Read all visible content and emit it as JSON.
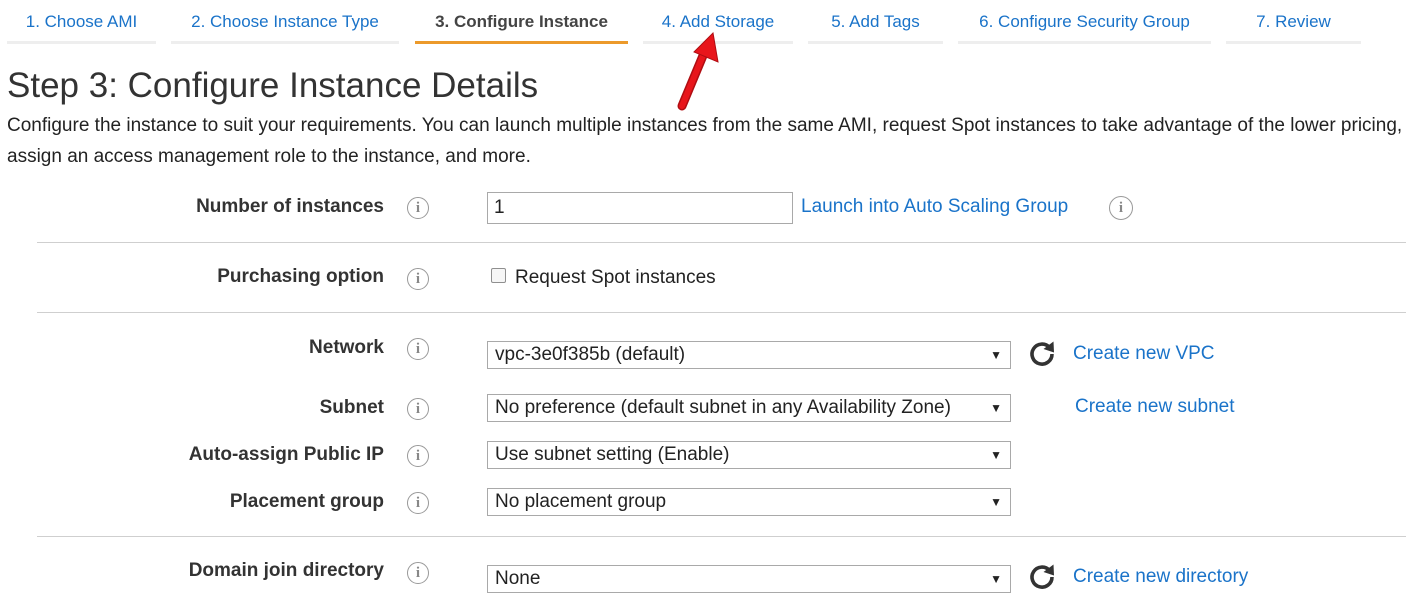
{
  "wizard": {
    "tabs": [
      {
        "label": "1. Choose AMI"
      },
      {
        "label": "2. Choose Instance Type"
      },
      {
        "label": "3. Configure Instance"
      },
      {
        "label": "4. Add Storage"
      },
      {
        "label": "5. Add Tags"
      },
      {
        "label": "6. Configure Security Group"
      },
      {
        "label": "7. Review"
      }
    ],
    "active_index": 2
  },
  "page": {
    "title": "Step 3: Configure Instance Details",
    "description": "Configure the instance to suit your requirements. You can launch multiple instances from the same AMI, request Spot instances to take advantage of the lower pricing, assign an access management role to the instance, and more."
  },
  "form": {
    "number_of_instances": {
      "label": "Number of instances",
      "value": "1",
      "link": "Launch into Auto Scaling Group"
    },
    "purchasing_option": {
      "label": "Purchasing option",
      "checkbox_label": "Request Spot instances",
      "checked": false
    },
    "network": {
      "label": "Network",
      "value": "vpc-3e0f385b (default)",
      "link": "Create new VPC"
    },
    "subnet": {
      "label": "Subnet",
      "value": "No preference (default subnet in any Availability Zone)",
      "link": "Create new subnet"
    },
    "auto_assign_public_ip": {
      "label": "Auto-assign Public IP",
      "value": "Use subnet setting (Enable)"
    },
    "placement_group": {
      "label": "Placement group",
      "value": "No placement group"
    },
    "domain_join_directory": {
      "label": "Domain join directory",
      "value": "None",
      "link": "Create new directory"
    }
  },
  "icons": {
    "info": "i",
    "caret": "▼"
  },
  "colors": {
    "link": "#1a73c9",
    "active_tab_underline": "#ec9a2b",
    "annotation_arrow": "#e8151b"
  }
}
